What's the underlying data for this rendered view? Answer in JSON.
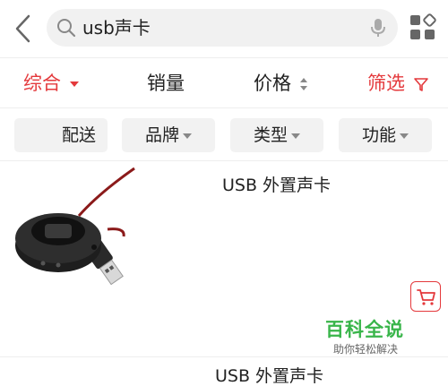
{
  "search": {
    "query": "usb声卡"
  },
  "sort": {
    "comprehensive": "综合",
    "sales": "销量",
    "price": "价格",
    "filter": "筛选"
  },
  "chips": [
    "配送",
    "品牌",
    "类型",
    "功能"
  ],
  "products": [
    {
      "title": "USB 外置声卡"
    },
    {
      "title": "USB 外置声卡"
    }
  ],
  "watermark": {
    "main": "百科全说",
    "sub": "助你轻松解决"
  },
  "colors": {
    "accent": "#e4393c",
    "watermark": "#39b54a",
    "chip_bg": "#f2f2f2",
    "search_bg": "#f1f1f1"
  }
}
